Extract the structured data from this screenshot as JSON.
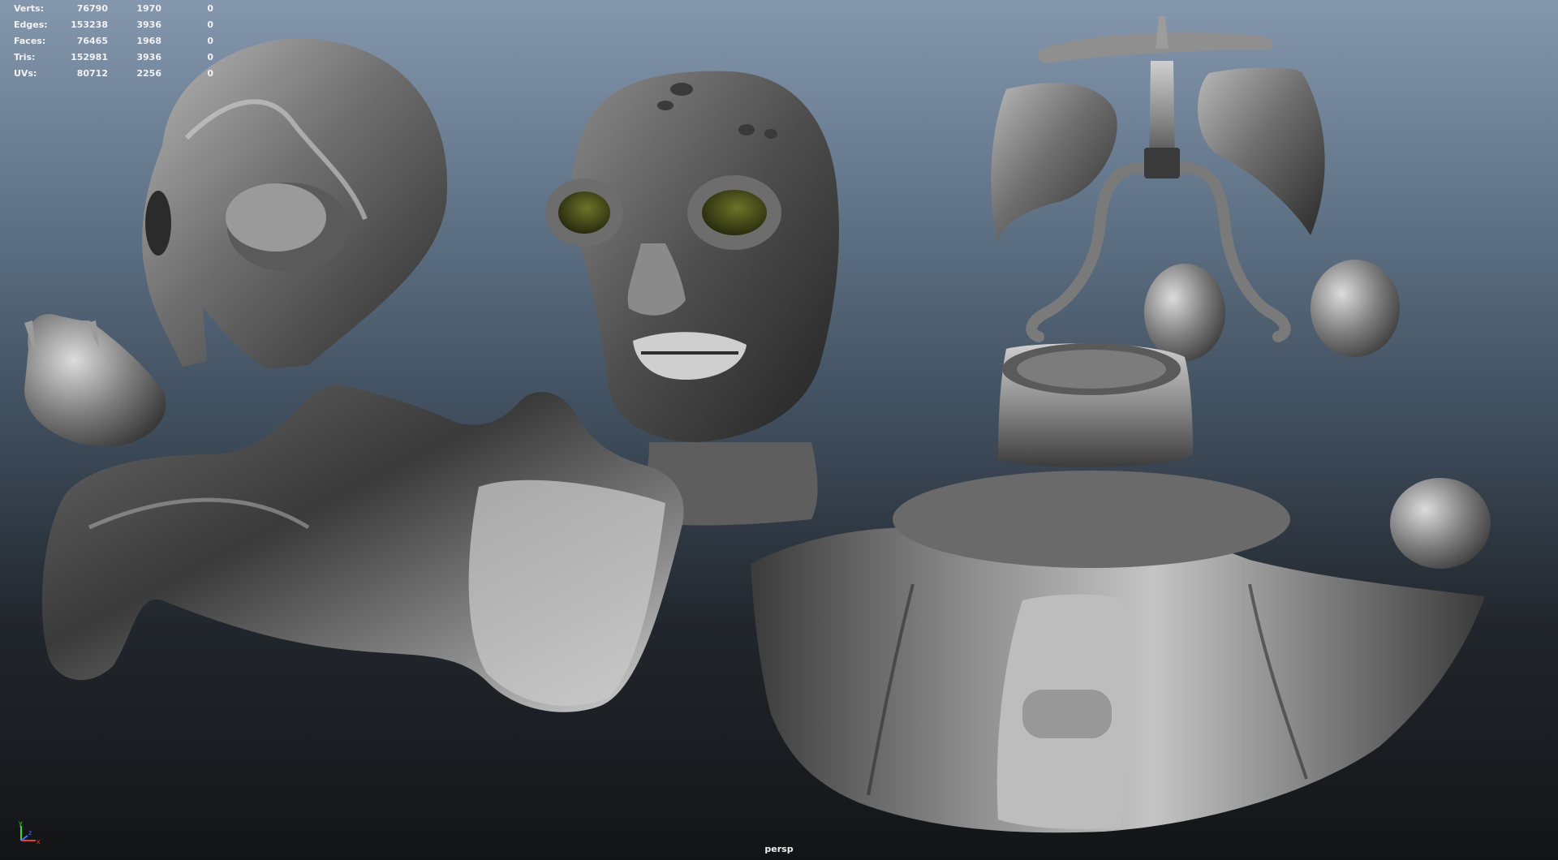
{
  "hud": {
    "rows": [
      {
        "label": "Verts:",
        "total": "76790",
        "selected": "1970",
        "component": "0"
      },
      {
        "label": "Edges:",
        "total": "153238",
        "selected": "3936",
        "component": "0"
      },
      {
        "label": "Faces:",
        "total": "76465",
        "selected": "1968",
        "component": "0"
      },
      {
        "label": "Tris:",
        "total": "152981",
        "selected": "3936",
        "component": "0"
      },
      {
        "label": "UVs:",
        "total": "80712",
        "selected": "2256",
        "component": "0"
      }
    ]
  },
  "camera": "persp",
  "axis": {
    "x": "x",
    "y": "y",
    "z": "z"
  },
  "colors": {
    "axis_x": "#e03c3c",
    "axis_y": "#3cd23c",
    "axis_z": "#4a6cff",
    "eye_color": "#3e4516"
  }
}
